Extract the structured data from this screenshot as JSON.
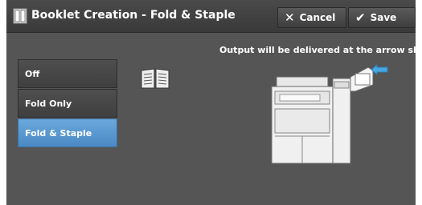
{
  "header": {
    "title": "Booklet Creation - Fold & Staple",
    "cancel_label": "Cancel",
    "save_label": "Save"
  },
  "hint": "Output will be delivered at the arrow shown.",
  "options": [
    {
      "label": "Off",
      "selected": false
    },
    {
      "label": "Fold Only",
      "selected": false
    },
    {
      "label": "Fold & Staple",
      "selected": true
    }
  ],
  "colors": {
    "selected": "#5b9bd5",
    "arrow": "#4aa8e0"
  },
  "icons": [
    "booklet-icon",
    "x-icon",
    "checkmark-icon",
    "open-book-icon",
    "machine-illustration",
    "output-arrow-icon"
  ]
}
